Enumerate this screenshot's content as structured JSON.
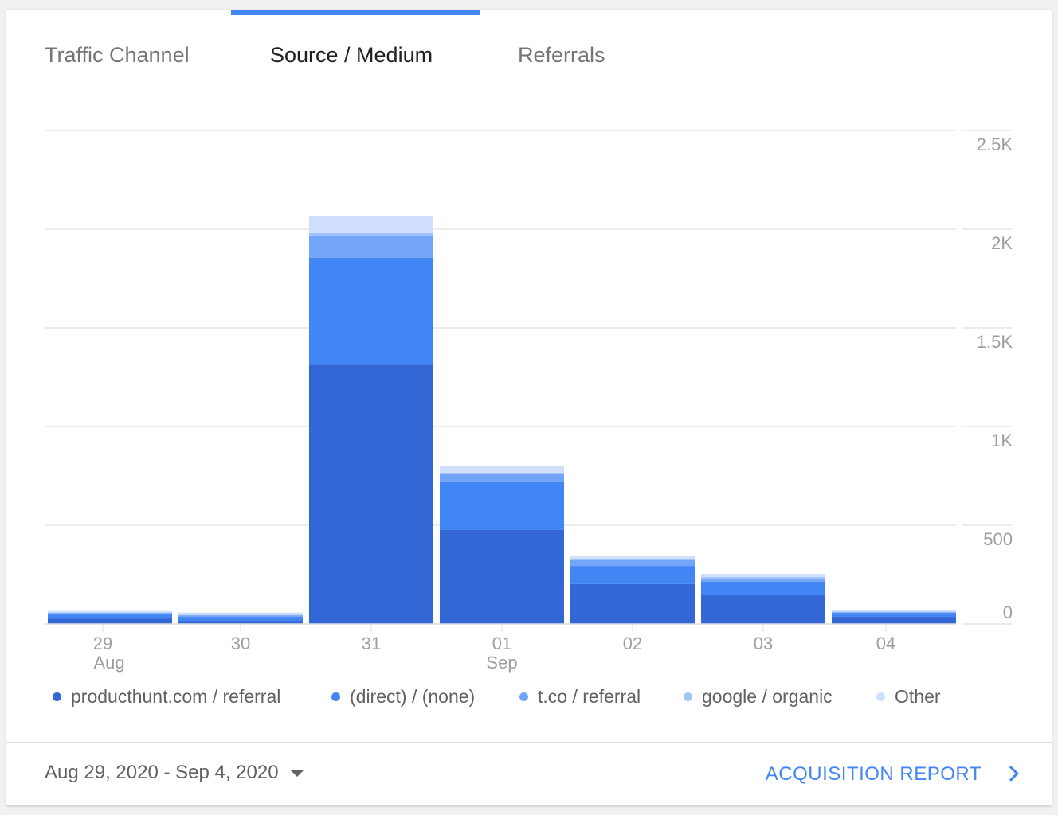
{
  "tabs": [
    {
      "label": "Traffic Channel",
      "active": false
    },
    {
      "label": "Source / Medium",
      "active": true
    },
    {
      "label": "Referrals",
      "active": false
    }
  ],
  "chart_data": {
    "type": "bar",
    "stacked": true,
    "categories": [
      "29",
      "30",
      "31",
      "01",
      "02",
      "03",
      "04"
    ],
    "category_sublabels": [
      "Aug",
      "",
      "",
      "Sep",
      "",
      "",
      ""
    ],
    "yticks": [
      "0",
      "500",
      "1K",
      "1.5K",
      "2K",
      "2.5K"
    ],
    "ylim": [
      0,
      2500
    ],
    "grid": true,
    "legend_position": "bottom",
    "series": [
      {
        "name": "producthunt.com / referral",
        "color": "#3367d6",
        "values": [
          28,
          16,
          1318,
          476,
          202,
          145,
          36
        ]
      },
      {
        "name": "(direct) / (none)",
        "color": "#4285f4",
        "values": [
          20,
          20,
          537,
          246,
          92,
          69,
          20
        ]
      },
      {
        "name": "t.co / referral",
        "color": "#72a4f7",
        "values": [
          8,
          8,
          109,
          36,
          29,
          16,
          4
        ]
      },
      {
        "name": "google / organic",
        "color": "#a1c2fa",
        "values": [
          2,
          2,
          16,
          8,
          8,
          8,
          2
        ]
      },
      {
        "name": "Other",
        "color": "#d0e0fc",
        "values": [
          8,
          12,
          89,
          36,
          16,
          16,
          8
        ]
      }
    ]
  },
  "footer": {
    "date_range": "Aug 29, 2020 - Sep 4, 2020",
    "report_link": "ACQUISITION REPORT"
  }
}
